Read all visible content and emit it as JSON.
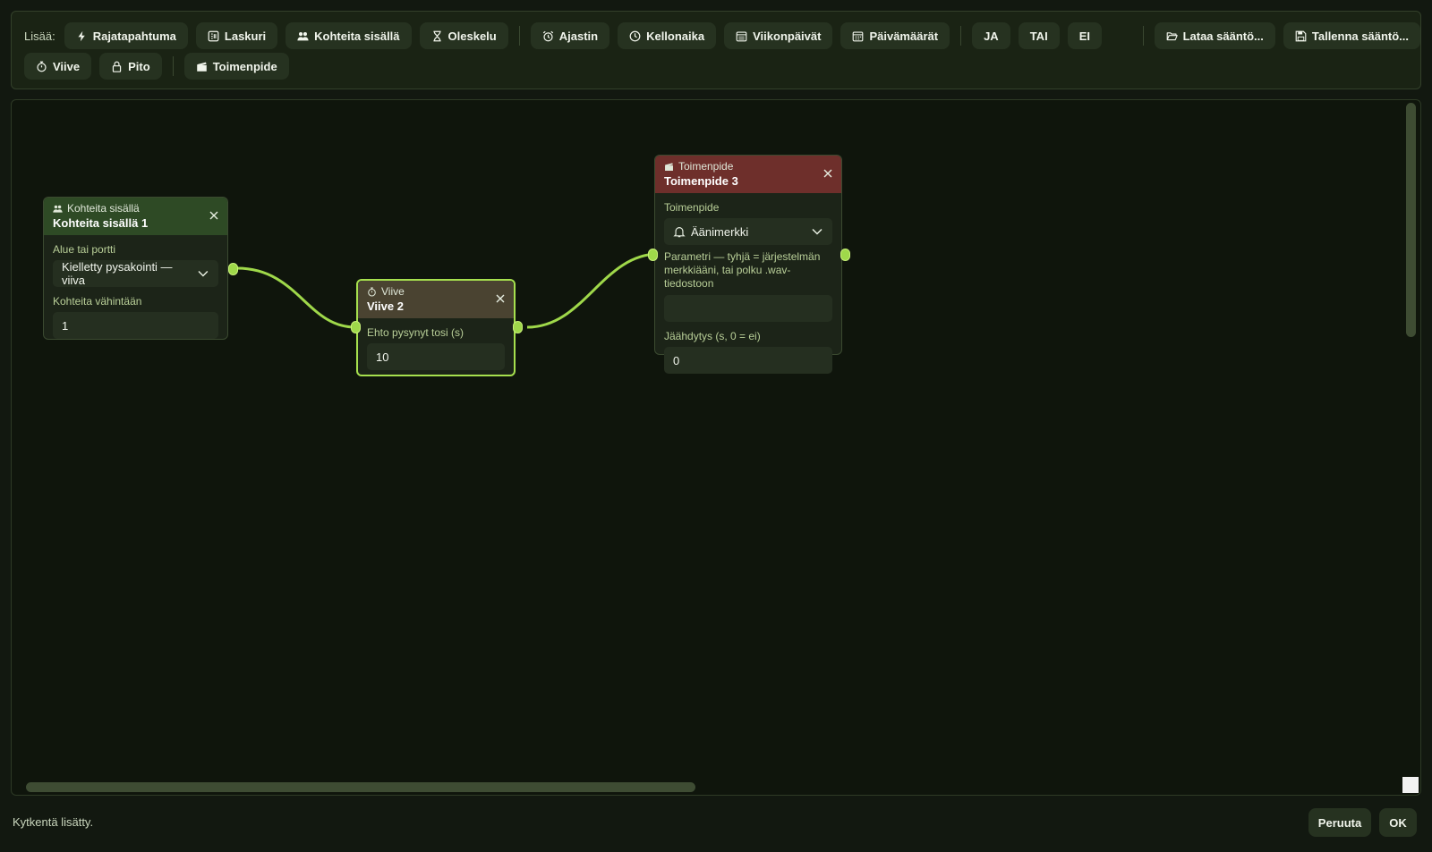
{
  "toolbar": {
    "add_label": "Lisää:",
    "row1": [
      {
        "label": "Rajatapahtuma",
        "icon": "bolt-icon"
      },
      {
        "label": "Laskuri",
        "icon": "counter-icon"
      },
      {
        "label": "Kohteita sisällä",
        "icon": "people-icon"
      },
      {
        "label": "Oleskelu",
        "icon": "hourglass-icon"
      },
      {
        "label": "Ajastin",
        "icon": "alarm-icon"
      },
      {
        "label": "Kellonaika",
        "icon": "clock-icon"
      },
      {
        "label": "Viikonpäivät",
        "icon": "calendar-week-icon"
      },
      {
        "label": "Päivämäärät",
        "icon": "calendar-icon"
      },
      {
        "label": "JA"
      },
      {
        "label": "TAI"
      },
      {
        "label": "EI"
      },
      {
        "label": "Lataa sääntö...",
        "icon": "folder-open-icon"
      },
      {
        "label": "Tallenna sääntö...",
        "icon": "save-icon"
      }
    ],
    "row2": [
      {
        "label": "Viive",
        "icon": "stopwatch-icon"
      },
      {
        "label": "Pito",
        "icon": "lock-icon"
      },
      {
        "label": "Toimenpide",
        "icon": "clapperboard-icon"
      }
    ]
  },
  "nodes": {
    "objects_inside": {
      "type": "Kohteita sisällä",
      "title": "Kohteita sisällä 1",
      "area_label": "Alue tai portti",
      "area_value": "Kielletty pysakointi — viiva",
      "min_label": "Kohteita vähintään",
      "min_value": "1"
    },
    "delay": {
      "type": "Viive",
      "title": "Viive 2",
      "cond_label": "Ehto pysynyt tosi (s)",
      "cond_value": "10"
    },
    "action": {
      "type": "Toimenpide",
      "title": "Toimenpide 3",
      "action_label": "Toimenpide",
      "action_value": "Äänimerkki",
      "param_label": "Parametri — tyhjä = järjestelmän merkkiääni, tai polku .wav-tiedostoon",
      "param_value": "",
      "cooldown_label": "Jäähdytys (s, 0 = ei)",
      "cooldown_value": "0"
    }
  },
  "status": "Kytkentä lisätty.",
  "buttons": {
    "cancel": "Peruuta",
    "ok": "OK"
  },
  "colors": {
    "accent": "#9fd84a",
    "header_green": "#2e4a25",
    "header_olive": "#4a4331",
    "header_red": "#6e2f2b"
  }
}
